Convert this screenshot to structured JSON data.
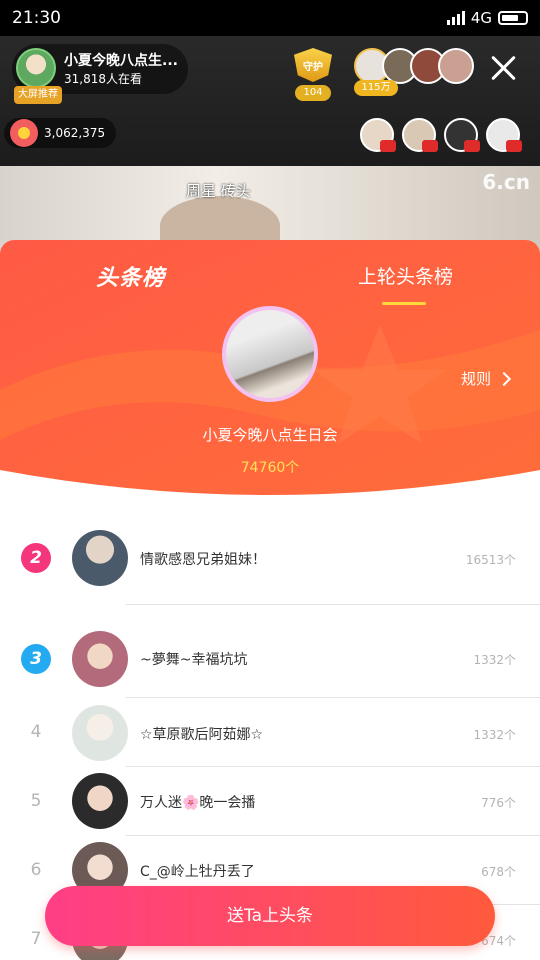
{
  "status_bar": {
    "time": "21:30",
    "network": "4G"
  },
  "live_header": {
    "host_name": "小夏今晚八点生...",
    "host_tag": "大屏推荐",
    "viewers": "31,818人在看",
    "guard_label": "守护",
    "guard_count": "104",
    "fans_count": "115万",
    "coins": "3,062,375"
  },
  "video": {
    "overlay_text": "周星  砖头",
    "watermark": "6.cn"
  },
  "panel": {
    "tab_current": "头条榜",
    "tab_previous": "上轮头条榜",
    "rules_label": "规则",
    "winner": {
      "name": "小夏今晚八点生日会",
      "count": "74760个"
    },
    "ranks": [
      {
        "rank": "2",
        "name": "情歌感恩兄弟姐妹！",
        "count": "16513个"
      },
      {
        "rank": "3",
        "name": "~夢舞~幸福坑坑",
        "count": "1332个"
      },
      {
        "rank": "4",
        "name": "☆草原歌后阿茹娜☆",
        "count": "1332个"
      },
      {
        "rank": "5",
        "name": "万人迷🌸晚一会播",
        "count": "776个"
      },
      {
        "rank": "6",
        "name": "C_@岭上牡丹丢了",
        "count": "678个"
      },
      {
        "rank": "7",
        "name": "",
        "count": "674个"
      }
    ]
  },
  "send_button": "送Ta上头条",
  "colors": {
    "accent_gradient_start": "#ff3e86",
    "accent_gradient_end": "#ff5a3c",
    "rank2": "#f5357c",
    "rank3": "#23aaf0",
    "highlight": "#ffe25a"
  }
}
